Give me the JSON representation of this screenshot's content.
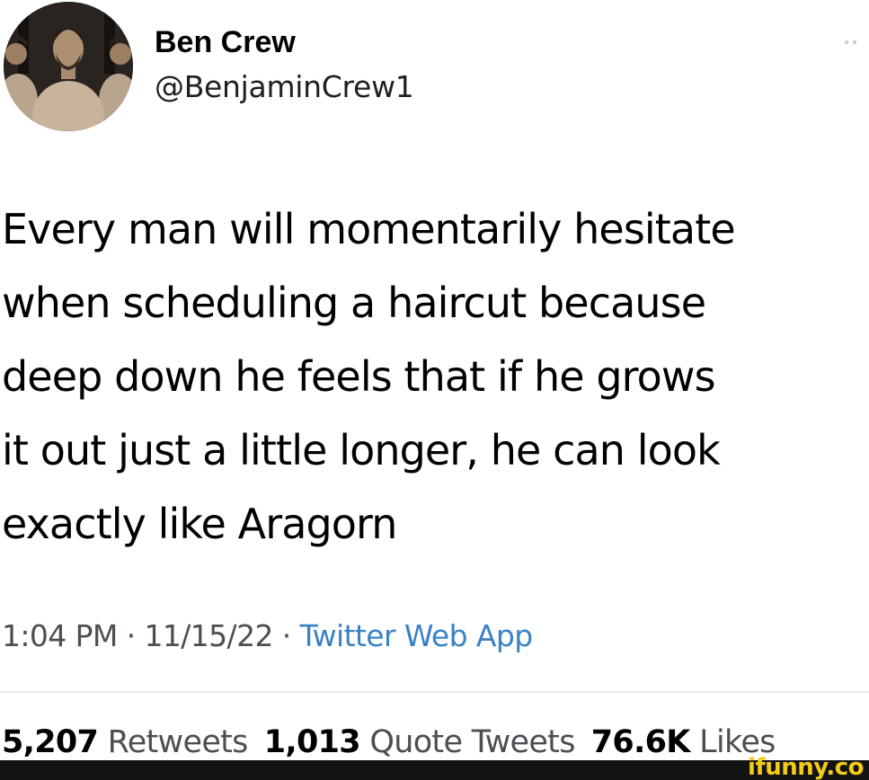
{
  "author": {
    "display_name": "Ben Crew",
    "handle": "@BenjaminCrew1",
    "avatar_icon": "profile-photo"
  },
  "menu": {
    "icon": "more-horizontal-icon"
  },
  "tweet": {
    "text": "Every man will momentarily hesitate\nwhen scheduling a haircut because\ndeep down he feels that if he grows\nit out just a little longer, he can look\nexactly like Aragorn"
  },
  "meta": {
    "time": "1:04 PM",
    "separator": " · ",
    "date": "11/15/22",
    "source": "Twitter Web App"
  },
  "stats": {
    "retweets_count": "5,207",
    "retweets_label": "Retweets",
    "quotes_count": "1,013",
    "quotes_label": "Quote Tweets",
    "likes_count": "76.6K",
    "likes_label": "Likes"
  },
  "watermark": {
    "text": "ifunny.co"
  },
  "colors": {
    "source_link": "#3b82c4",
    "watermark": "#f3cc17",
    "footer_bar": "#131313"
  }
}
